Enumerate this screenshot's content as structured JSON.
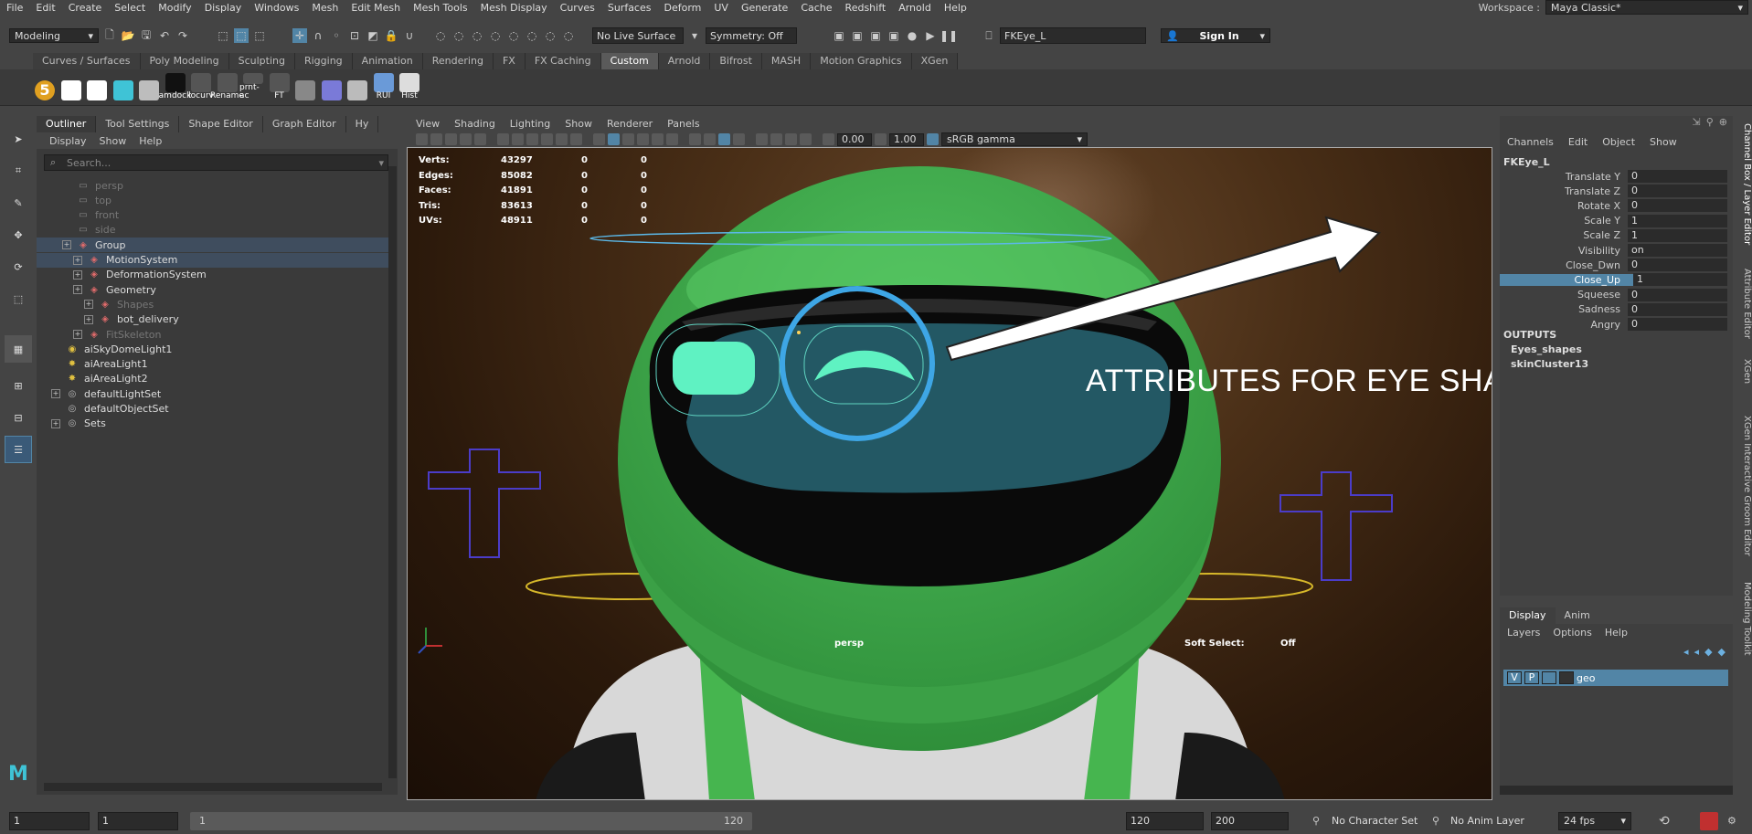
{
  "menubar": {
    "items": [
      "File",
      "Edit",
      "Create",
      "Select",
      "Modify",
      "Display",
      "Windows",
      "Mesh",
      "Edit Mesh",
      "Mesh Tools",
      "Mesh Display",
      "Curves",
      "Surfaces",
      "Deform",
      "UV",
      "Generate",
      "Cache",
      "Redshift",
      "Arnold",
      "Help"
    ],
    "workspace_label": "Workspace :",
    "workspace_value": "Maya Classic*"
  },
  "statusline": {
    "mode": "Modeling",
    "live_surface": "No Live Surface",
    "symmetry": "Symmetry: Off",
    "object_name": "FKEye_L",
    "sign_in": "Sign In"
  },
  "shelf": {
    "tabs": [
      "Curves / Surfaces",
      "Poly Modeling",
      "Sculpting",
      "Rigging",
      "Animation",
      "Rendering",
      "FX",
      "FX Caching",
      "Custom",
      "Arnold",
      "Bifrost",
      "MASH",
      "Motion Graphics",
      "XGen"
    ],
    "active_tab": "Custom",
    "icons": [
      {
        "name": "five-icon",
        "label": "5"
      },
      {
        "name": "figure-icon",
        "label": ""
      },
      {
        "name": "skull-icon",
        "label": ""
      },
      {
        "name": "cyan-figure-icon",
        "label": ""
      },
      {
        "name": "cube-icon",
        "label": ""
      },
      {
        "name": "m-amdock-icon",
        "label": "amdock"
      },
      {
        "name": "m-locurv-icon",
        "label": "locurv"
      },
      {
        "name": "rename-icon",
        "label": "Rename"
      },
      {
        "name": "prnt-ac-icon",
        "label": "prnt-ac"
      },
      {
        "name": "ft-icon",
        "label": "FT"
      },
      {
        "name": "grid-icon",
        "label": ""
      },
      {
        "name": "frame-icon",
        "label": ""
      },
      {
        "name": "copy-icon",
        "label": ""
      },
      {
        "name": "rui-icon",
        "label": "RUI"
      },
      {
        "name": "hist-icon",
        "label": "Hist"
      }
    ]
  },
  "outliner": {
    "tabs": [
      "Outliner",
      "Tool Settings",
      "Shape Editor",
      "Graph Editor",
      "Hy"
    ],
    "menu": [
      "Display",
      "Show",
      "Help"
    ],
    "search_placeholder": "Search...",
    "rows": [
      {
        "label": "persp",
        "indent": 1,
        "icon": "camera",
        "dim": true,
        "exp": false
      },
      {
        "label": "top",
        "indent": 1,
        "icon": "camera",
        "dim": true,
        "exp": false
      },
      {
        "label": "front",
        "indent": 1,
        "icon": "camera",
        "dim": true,
        "exp": false
      },
      {
        "label": "side",
        "indent": 1,
        "icon": "camera",
        "dim": true,
        "exp": false
      },
      {
        "label": "Group",
        "indent": 1,
        "icon": "group",
        "dim": false,
        "exp": true,
        "sel": true
      },
      {
        "label": "MotionSystem",
        "indent": 2,
        "icon": "group",
        "dim": false,
        "exp": true,
        "sel": true
      },
      {
        "label": "DeformationSystem",
        "indent": 2,
        "icon": "group",
        "dim": false,
        "exp": true
      },
      {
        "label": "Geometry",
        "indent": 2,
        "icon": "group",
        "dim": false,
        "exp": true
      },
      {
        "label": "Shapes",
        "indent": 3,
        "icon": "group",
        "dim": true,
        "exp": true
      },
      {
        "label": "bot_delivery",
        "indent": 3,
        "icon": "group",
        "dim": false,
        "exp": true
      },
      {
        "label": "FitSkeleton",
        "indent": 2,
        "icon": "group",
        "dim": true,
        "exp": true
      },
      {
        "label": "aiSkyDomeLight1",
        "indent": 0,
        "icon": "sky",
        "dim": false,
        "exp": false
      },
      {
        "label": "aiAreaLight1",
        "indent": 0,
        "icon": "light",
        "dim": false,
        "exp": false
      },
      {
        "label": "aiAreaLight2",
        "indent": 0,
        "icon": "light",
        "dim": false,
        "exp": false
      },
      {
        "label": "defaultLightSet",
        "indent": 0,
        "icon": "set",
        "dim": false,
        "exp": true
      },
      {
        "label": "defaultObjectSet",
        "indent": 0,
        "icon": "set",
        "dim": false,
        "exp": false
      },
      {
        "label": "Sets",
        "indent": 0,
        "icon": "set",
        "dim": false,
        "exp": true
      }
    ]
  },
  "viewport": {
    "menu": [
      "View",
      "Shading",
      "Lighting",
      "Show",
      "Renderer",
      "Panels"
    ],
    "exposure": "0.00",
    "gamma": "1.00",
    "color_space": "sRGB gamma",
    "stats": [
      {
        "label": "Verts:",
        "v": "43297",
        "a": "0",
        "b": "0"
      },
      {
        "label": "Edges:",
        "v": "85082",
        "a": "0",
        "b": "0"
      },
      {
        "label": "Faces:",
        "v": "41891",
        "a": "0",
        "b": "0"
      },
      {
        "label": "Tris:",
        "v": "83613",
        "a": "0",
        "b": "0"
      },
      {
        "label": "UVs:",
        "v": "48911",
        "a": "0",
        "b": "0"
      }
    ],
    "camera_label": "persp",
    "soft_select_label": "Soft Select:",
    "soft_select_value": "Off",
    "annotation": "ATTRIBUTES FOR EYE SHAPES"
  },
  "channelbox": {
    "menu": [
      "Channels",
      "Edit",
      "Object",
      "Show"
    ],
    "object": "FKEye_L",
    "attributes": [
      {
        "name": "Translate Y",
        "value": "0"
      },
      {
        "name": "Translate Z",
        "value": "0"
      },
      {
        "name": "Rotate X",
        "value": "0"
      },
      {
        "name": "Scale Y",
        "value": "1"
      },
      {
        "name": "Scale Z",
        "value": "1"
      },
      {
        "name": "Visibility",
        "value": "on"
      },
      {
        "name": "Close_Dwn",
        "value": "0"
      },
      {
        "name": "Close_Up",
        "value": "1",
        "highlight": true
      },
      {
        "name": "Squeese",
        "value": "0"
      },
      {
        "name": "Sadness",
        "value": "0"
      },
      {
        "name": "Angry",
        "value": "0"
      }
    ],
    "outputs_label": "OUTPUTS",
    "outputs": [
      "Eyes_shapes",
      "skinCluster13"
    ]
  },
  "layers": {
    "tabs": [
      "Display",
      "Anim"
    ],
    "menu": [
      "Layers",
      "Options",
      "Help"
    ],
    "layer": {
      "v": "V",
      "p": "P",
      "name": "geo"
    }
  },
  "right_tabs": [
    "Channel Box / Layer Editor",
    "Attribute Editor",
    "XGen",
    "XGen Interactive Groom Editor",
    "Modeling Toolkit"
  ],
  "timebar": {
    "start": "1",
    "current": "1",
    "range_start": "1",
    "range_end_label": "120",
    "end": "120",
    "end2": "200",
    "char_set": "No Character Set",
    "anim_layer": "No Anim Layer",
    "fps": "24 fps"
  }
}
